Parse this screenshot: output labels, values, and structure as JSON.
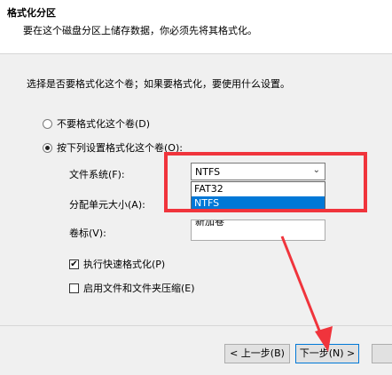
{
  "header": {
    "title": "格式化分区",
    "subtitle": "要在这个磁盘分区上储存数据，你必须先将其格式化。"
  },
  "instruction": "选择是否要格式化这个卷；如果要格式化，要使用什么设置。",
  "radios": {
    "no_format": {
      "label": "不要格式化这个卷(D)",
      "checked": false
    },
    "format": {
      "label": "按下列设置格式化这个卷(O):",
      "checked": true
    }
  },
  "fields": {
    "file_system_label": "文件系统(F):",
    "file_system_value": "NTFS",
    "file_system_options": [
      "FAT32",
      "NTFS"
    ],
    "allocation_label": "分配单元大小(A):",
    "volume_label": "卷标(V):",
    "volume_value": "新加卷"
  },
  "checkboxes": {
    "quick_format": {
      "label": "执行快速格式化(P)",
      "checked": true,
      "mark": "✔"
    },
    "compression": {
      "label": "启用文件和文件夹压缩(E)",
      "checked": false
    }
  },
  "buttons": {
    "back": "< 上一步(B)",
    "next": "下一步(N) >"
  },
  "icons": {
    "chevron": "⌄"
  },
  "colors": {
    "annotation_red": "#f0343c",
    "selected_blue": "#0078d7"
  }
}
